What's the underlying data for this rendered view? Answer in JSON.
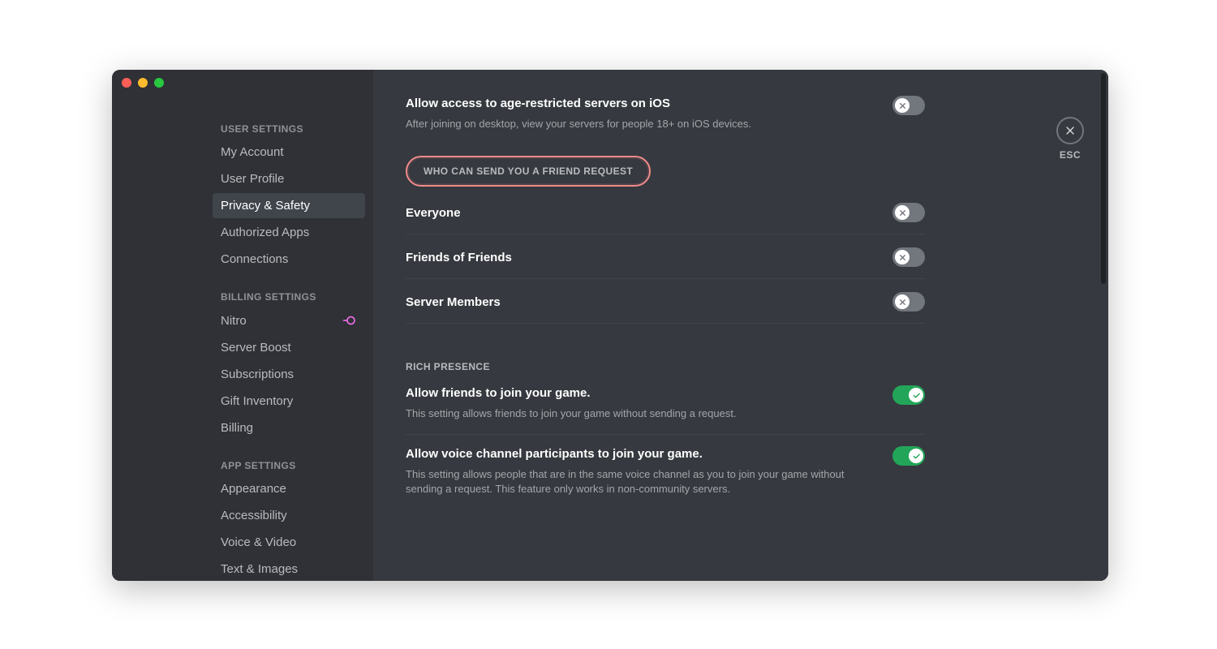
{
  "sidebar": {
    "sections": [
      {
        "header": "USER SETTINGS",
        "items": [
          {
            "label": "My Account"
          },
          {
            "label": "User Profile"
          },
          {
            "label": "Privacy & Safety",
            "active": true
          },
          {
            "label": "Authorized Apps"
          },
          {
            "label": "Connections"
          }
        ]
      },
      {
        "header": "BILLING SETTINGS",
        "items": [
          {
            "label": "Nitro",
            "badge_icon": "nitro-icon"
          },
          {
            "label": "Server Boost"
          },
          {
            "label": "Subscriptions"
          },
          {
            "label": "Gift Inventory"
          },
          {
            "label": "Billing"
          }
        ]
      },
      {
        "header": "APP SETTINGS",
        "items": [
          {
            "label": "Appearance"
          },
          {
            "label": "Accessibility"
          },
          {
            "label": "Voice & Video"
          },
          {
            "label": "Text & Images"
          }
        ]
      }
    ]
  },
  "content": {
    "esc_label": "ESC",
    "age_restricted": {
      "title": "Allow access to age-restricted servers on iOS",
      "desc": "After joining on desktop, view your servers for people 18+ on iOS devices.",
      "toggle": false
    },
    "friend_request_header": "WHO CAN SEND YOU A FRIEND REQUEST",
    "friend_request_highlighted": true,
    "friend_options": [
      {
        "label": "Everyone",
        "toggle": false
      },
      {
        "label": "Friends of Friends",
        "toggle": false
      },
      {
        "label": "Server Members",
        "toggle": false
      }
    ],
    "rich_presence_header": "RICH PRESENCE",
    "rich_presence": [
      {
        "title": "Allow friends to join your game.",
        "desc": "This setting allows friends to join your game without sending a request.",
        "toggle": true
      },
      {
        "title": "Allow voice channel participants to join your game.",
        "desc": "This setting allows people that are in the same voice channel as you to join your game without sending a request. This feature only works in non-community servers.",
        "toggle": true
      }
    ]
  },
  "colors": {
    "bg_primary": "#36393f",
    "bg_secondary": "#2f3136",
    "toggle_on": "#23a559",
    "toggle_off": "#72767d",
    "highlight_ring": "#f08a8a"
  }
}
